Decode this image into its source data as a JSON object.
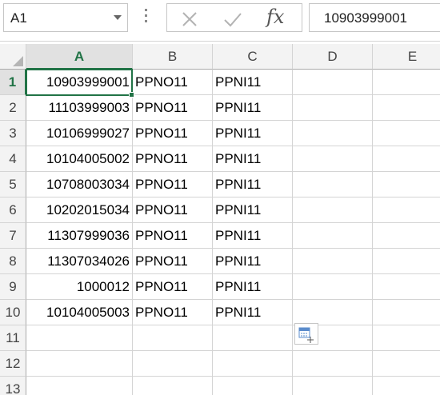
{
  "name_box": {
    "value": "A1"
  },
  "formula_bar": {
    "cancel_icon": "close-icon",
    "enter_icon": "checkmark-icon",
    "function_label": "fx",
    "value": "10903999001"
  },
  "columns": [
    "A",
    "B",
    "C",
    "D",
    "E"
  ],
  "selected_column": "A",
  "selected_row": "1",
  "rows": [
    {
      "num": "1",
      "cells": [
        "10903999001",
        "PPNO11",
        "PPNI11",
        "",
        ""
      ]
    },
    {
      "num": "2",
      "cells": [
        "11103999003",
        "PPNO11",
        "PPNI11",
        "",
        ""
      ]
    },
    {
      "num": "3",
      "cells": [
        "10106999027",
        "PPNO11",
        "PPNI11",
        "",
        ""
      ]
    },
    {
      "num": "4",
      "cells": [
        "10104005002",
        "PPNO11",
        "PPNI11",
        "",
        ""
      ]
    },
    {
      "num": "5",
      "cells": [
        "10708003034",
        "PPNO11",
        "PPNI11",
        "",
        ""
      ]
    },
    {
      "num": "6",
      "cells": [
        "10202015034",
        "PPNO11",
        "PPNI11",
        "",
        ""
      ]
    },
    {
      "num": "7",
      "cells": [
        "11307999036",
        "PPNO11",
        "PPNI11",
        "",
        ""
      ]
    },
    {
      "num": "8",
      "cells": [
        "11307034026",
        "PPNO11",
        "PPNI11",
        "",
        ""
      ]
    },
    {
      "num": "9",
      "cells": [
        "1000012",
        "PPNO11",
        "PPNI11",
        "",
        ""
      ]
    },
    {
      "num": "10",
      "cells": [
        "10104005003",
        "PPNO11",
        "PPNI11",
        "",
        ""
      ]
    },
    {
      "num": "11",
      "cells": [
        "",
        "",
        "",
        "",
        ""
      ]
    },
    {
      "num": "12",
      "cells": [
        "",
        "",
        "",
        "",
        ""
      ]
    },
    {
      "num": "13",
      "cells": [
        "",
        "",
        "",
        "",
        ""
      ]
    }
  ],
  "colors": {
    "accent": "#217346",
    "gridline": "#d4d4d4",
    "header_bg": "#f3f3f3"
  }
}
